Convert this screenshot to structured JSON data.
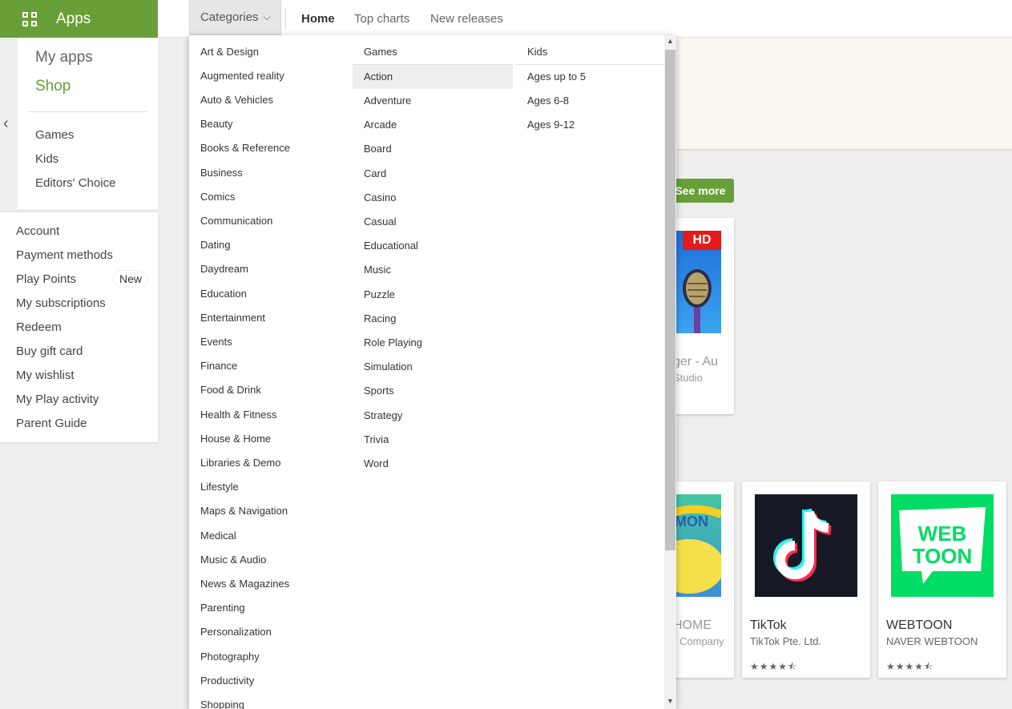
{
  "topbar": {
    "apps_label": "Apps",
    "categories_label": "Categories",
    "nav": [
      "Home",
      "Top charts",
      "New releases"
    ]
  },
  "sidebar": {
    "my_apps": "My apps",
    "shop": "Shop",
    "sub_items": [
      "Games",
      "Kids",
      "Editors' Choice"
    ],
    "account_items": [
      "Account",
      "Payment methods",
      "Play Points",
      "My subscriptions",
      "Redeem",
      "Buy gift card",
      "My wishlist",
      "My Play activity",
      "Parent Guide"
    ],
    "play_points_badge": "New"
  },
  "main": {
    "see_more": "See more",
    "card1": {
      "title": "ger - Au",
      "sub": "Studio",
      "badge": "HD"
    },
    "card2": {
      "title": "HOME",
      "sub": "Company"
    },
    "card3": {
      "title": "TikTok",
      "sub": "TikTok Pte. Ltd.",
      "stars": "★★★★⯪"
    },
    "card4": {
      "title": "WEBTOON",
      "sub": "NAVER WEBTOON",
      "stars": "★★★★⯪",
      "logo_text": "WEB TOON"
    }
  },
  "dropdown": {
    "col1": [
      "Art & Design",
      "Augmented reality",
      "Auto & Vehicles",
      "Beauty",
      "Books & Reference",
      "Business",
      "Comics",
      "Communication",
      "Dating",
      "Daydream",
      "Education",
      "Entertainment",
      "Events",
      "Finance",
      "Food & Drink",
      "Health & Fitness",
      "House & Home",
      "Libraries & Demo",
      "Lifestyle",
      "Maps & Navigation",
      "Medical",
      "Music & Audio",
      "News & Magazines",
      "Parenting",
      "Personalization",
      "Photography",
      "Productivity",
      "Shopping"
    ],
    "col2_header": "Games",
    "col2": [
      "Action",
      "Adventure",
      "Arcade",
      "Board",
      "Card",
      "Casino",
      "Casual",
      "Educational",
      "Music",
      "Puzzle",
      "Racing",
      "Role Playing",
      "Simulation",
      "Sports",
      "Strategy",
      "Trivia",
      "Word"
    ],
    "col3_header": "Kids",
    "col3": [
      "Ages up to 5",
      "Ages 6-8",
      "Ages 9-12"
    ]
  },
  "colors": {
    "accent": "#689f38",
    "hd_red": "#e51a1a",
    "webtoon_green": "#00dc64",
    "tiktok_bg": "#161823"
  }
}
